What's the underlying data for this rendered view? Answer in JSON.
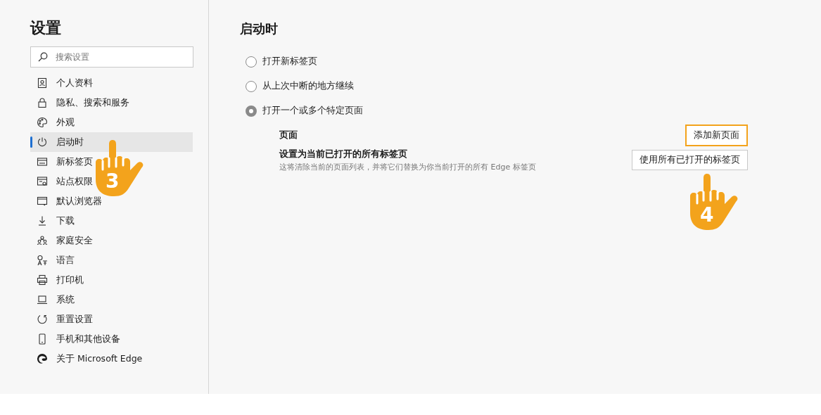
{
  "sidebar": {
    "title": "设置",
    "search": {
      "placeholder": "搜索设置"
    },
    "items": [
      {
        "label": "个人资料",
        "selected": false
      },
      {
        "label": "隐私、搜索和服务",
        "selected": false
      },
      {
        "label": "外观",
        "selected": false
      },
      {
        "label": "启动时",
        "selected": true
      },
      {
        "label": "新标签页",
        "selected": false
      },
      {
        "label": "站点权限",
        "selected": false
      },
      {
        "label": "默认浏览器",
        "selected": false
      },
      {
        "label": "下载",
        "selected": false
      },
      {
        "label": "家庭安全",
        "selected": false
      },
      {
        "label": "语言",
        "selected": false
      },
      {
        "label": "打印机",
        "selected": false
      },
      {
        "label": "系统",
        "selected": false
      },
      {
        "label": "重置设置",
        "selected": false
      },
      {
        "label": "手机和其他设备",
        "selected": false
      },
      {
        "label": "关于 Microsoft Edge",
        "selected": false
      }
    ]
  },
  "main": {
    "title": "启动时",
    "options": [
      {
        "label": "打开新标签页",
        "selected": false
      },
      {
        "label": "从上次中断的地方继续",
        "selected": false
      },
      {
        "label": "打开一个或多个特定页面",
        "selected": true
      }
    ],
    "rows": [
      {
        "title": "页面",
        "button": "添加新页面",
        "highlighted": true
      },
      {
        "title": "设置为当前已打开的所有标签页",
        "description": "这将清除当前的页面列表，并将它们替换为你当前打开的所有 Edge 标签页",
        "button": "使用所有已打开的标签页",
        "highlighted": false
      }
    ]
  },
  "annotations": [
    {
      "step": "3"
    },
    {
      "step": "4"
    }
  ]
}
